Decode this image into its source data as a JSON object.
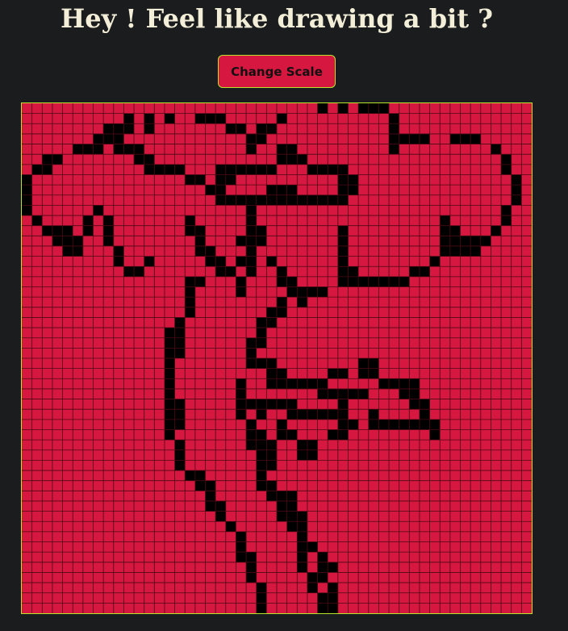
{
  "title": "Hey ! Feel like drawing a bit ?",
  "button": {
    "label": "Change Scale"
  },
  "colors": {
    "background": "#1b1c1e",
    "title": "#f3eed8",
    "cell_empty": "#d6173f",
    "cell_filled": "#000000",
    "grid_line": "#4a0a14",
    "accent_border": "#b8e62e"
  },
  "grid": {
    "cols": 50,
    "rows": 50,
    "filled_rows": [
      [
        [
          29,
          29
        ],
        [
          31,
          31
        ],
        [
          33,
          35
        ]
      ],
      [
        [
          10,
          10
        ],
        [
          12,
          12
        ],
        [
          14,
          14
        ],
        [
          17,
          19
        ],
        [
          25,
          25
        ],
        [
          36,
          36
        ]
      ],
      [
        [
          8,
          10
        ],
        [
          12,
          12
        ],
        [
          20,
          21
        ],
        [
          23,
          24
        ],
        [
          36,
          36
        ]
      ],
      [
        [
          7,
          9
        ],
        [
          22,
          23
        ],
        [
          36,
          36
        ],
        [
          37,
          39
        ],
        [
          42,
          44
        ]
      ],
      [
        [
          5,
          7
        ],
        [
          9,
          11
        ],
        [
          22,
          22
        ],
        [
          25,
          26
        ],
        [
          36,
          36
        ],
        [
          46,
          46
        ]
      ],
      [
        [
          2,
          3
        ],
        [
          11,
          12
        ],
        [
          25,
          27
        ],
        [
          47,
          47
        ]
      ],
      [
        [
          1,
          2
        ],
        [
          12,
          15
        ],
        [
          19,
          24
        ],
        [
          28,
          31
        ],
        [
          47,
          47
        ]
      ],
      [
        [
          0,
          0
        ],
        [
          16,
          17
        ],
        [
          19,
          20
        ],
        [
          31,
          32
        ],
        [
          48,
          48
        ]
      ],
      [
        [
          0,
          0
        ],
        [
          18,
          19
        ],
        [
          24,
          26
        ],
        [
          31,
          32
        ],
        [
          48,
          48
        ]
      ],
      [
        [
          0,
          0
        ],
        [
          19,
          30
        ],
        [
          31,
          31
        ],
        [
          48,
          48
        ]
      ],
      [
        [
          0,
          0
        ],
        [
          7,
          7
        ],
        [
          22,
          22
        ],
        [
          47,
          47
        ]
      ],
      [
        [
          1,
          1
        ],
        [
          6,
          6
        ],
        [
          8,
          8
        ],
        [
          16,
          16
        ],
        [
          22,
          22
        ],
        [
          41,
          41
        ],
        [
          47,
          47
        ]
      ],
      [
        [
          2,
          4
        ],
        [
          6,
          6
        ],
        [
          8,
          8
        ],
        [
          16,
          17
        ],
        [
          22,
          23
        ],
        [
          31,
          31
        ],
        [
          41,
          42
        ],
        [
          46,
          46
        ]
      ],
      [
        [
          3,
          5
        ],
        [
          8,
          8
        ],
        [
          17,
          17
        ],
        [
          21,
          23
        ],
        [
          31,
          31
        ],
        [
          41,
          44
        ],
        [
          45,
          45
        ]
      ],
      [
        [
          4,
          5
        ],
        [
          9,
          9
        ],
        [
          17,
          18
        ],
        [
          22,
          22
        ],
        [
          31,
          31
        ],
        [
          41,
          44
        ]
      ],
      [
        [
          9,
          9
        ],
        [
          12,
          12
        ],
        [
          18,
          19
        ],
        [
          21,
          22
        ],
        [
          24,
          24
        ],
        [
          31,
          31
        ],
        [
          40,
          40
        ]
      ],
      [
        [
          10,
          11
        ],
        [
          19,
          20
        ],
        [
          22,
          22
        ],
        [
          25,
          25
        ],
        [
          31,
          32
        ],
        [
          38,
          39
        ]
      ],
      [
        [
          16,
          17
        ],
        [
          21,
          21
        ],
        [
          25,
          26
        ],
        [
          31,
          31
        ],
        [
          32,
          37
        ]
      ],
      [
        [
          16,
          16
        ],
        [
          21,
          21
        ],
        [
          26,
          29
        ]
      ],
      [
        [
          16,
          16
        ],
        [
          25,
          25
        ],
        [
          27,
          27
        ]
      ],
      [
        [
          16,
          16
        ],
        [
          24,
          25
        ]
      ],
      [
        [
          15,
          15
        ],
        [
          23,
          24
        ]
      ],
      [
        [
          14,
          15
        ],
        [
          23,
          23
        ]
      ],
      [
        [
          14,
          15
        ],
        [
          22,
          23
        ]
      ],
      [
        [
          14,
          15
        ],
        [
          22,
          22
        ]
      ],
      [
        [
          14,
          14
        ],
        [
          22,
          22
        ],
        [
          23,
          24
        ],
        [
          33,
          34
        ]
      ],
      [
        [
          14,
          14
        ],
        [
          24,
          25
        ],
        [
          30,
          31
        ],
        [
          33,
          34
        ]
      ],
      [
        [
          14,
          14
        ],
        [
          21,
          21
        ],
        [
          24,
          29
        ],
        [
          35,
          38
        ]
      ],
      [
        [
          14,
          14
        ],
        [
          21,
          21
        ],
        [
          29,
          33
        ],
        [
          37,
          38
        ]
      ],
      [
        [
          14,
          15
        ],
        [
          21,
          26
        ],
        [
          31,
          31
        ],
        [
          38,
          39
        ]
      ],
      [
        [
          14,
          15
        ],
        [
          21,
          21
        ],
        [
          23,
          23
        ],
        [
          26,
          31
        ],
        [
          34,
          34
        ],
        [
          39,
          39
        ]
      ],
      [
        [
          14,
          15
        ],
        [
          22,
          22
        ],
        [
          25,
          25
        ],
        [
          31,
          32
        ],
        [
          34,
          40
        ]
      ],
      [
        [
          14,
          14
        ],
        [
          22,
          23
        ],
        [
          25,
          26
        ],
        [
          30,
          31
        ],
        [
          40,
          40
        ]
      ],
      [
        [
          15,
          15
        ],
        [
          22,
          24
        ],
        [
          27,
          28
        ]
      ],
      [
        [
          15,
          15
        ],
        [
          23,
          24
        ],
        [
          27,
          28
        ]
      ],
      [
        [
          15,
          15
        ],
        [
          23,
          24
        ]
      ],
      [
        [
          16,
          17
        ],
        [
          23,
          23
        ]
      ],
      [
        [
          17,
          18
        ],
        [
          23,
          24
        ]
      ],
      [
        [
          18,
          18
        ],
        [
          24,
          26
        ]
      ],
      [
        [
          18,
          19
        ],
        [
          25,
          26
        ]
      ],
      [
        [
          19,
          19
        ],
        [
          25,
          27
        ]
      ],
      [
        [
          20,
          20
        ],
        [
          26,
          27
        ]
      ],
      [
        [
          21,
          21
        ],
        [
          27,
          27
        ]
      ],
      [
        [
          21,
          21
        ],
        [
          27,
          27
        ],
        [
          28,
          28
        ]
      ],
      [
        [
          21,
          22
        ],
        [
          27,
          27
        ],
        [
          29,
          29
        ]
      ],
      [
        [
          22,
          22
        ],
        [
          27,
          27
        ],
        [
          29,
          30
        ]
      ],
      [
        [
          22,
          22
        ],
        [
          28,
          28
        ],
        [
          29,
          29
        ]
      ],
      [
        [
          23,
          23
        ],
        [
          28,
          28
        ],
        [
          30,
          30
        ]
      ],
      [
        [
          23,
          23
        ],
        [
          29,
          29
        ],
        [
          30,
          30
        ]
      ],
      [
        [
          23,
          23
        ],
        [
          29,
          30
        ]
      ]
    ]
  }
}
